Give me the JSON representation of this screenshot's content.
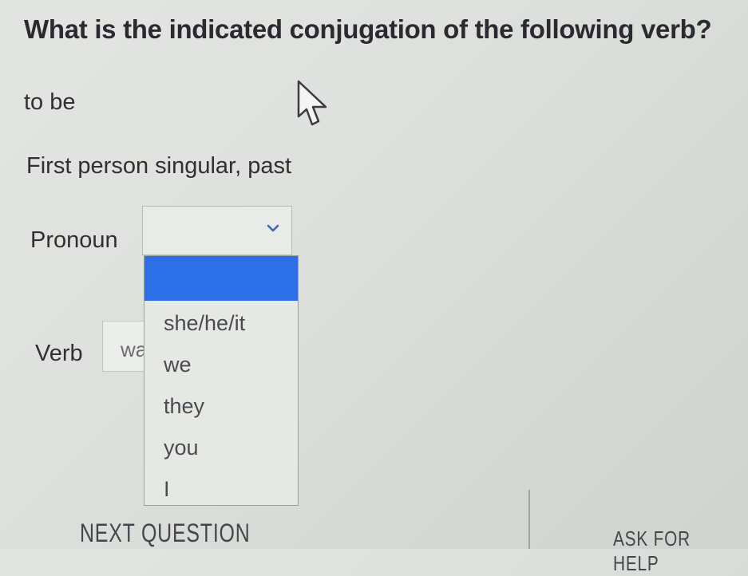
{
  "question": {
    "prompt": "What is the indicated conjugation of the following verb?"
  },
  "verb": {
    "term": "to be"
  },
  "instruction": {
    "text": "First person singular, past"
  },
  "pronoun": {
    "label": "Pronoun",
    "selected": "",
    "options": [
      {
        "label": "",
        "highlighted": true
      },
      {
        "label": "she/he/it"
      },
      {
        "label": "we"
      },
      {
        "label": "they"
      },
      {
        "label": "you"
      },
      {
        "label": "I"
      }
    ]
  },
  "verb_field": {
    "label": "Verb",
    "value": "wa"
  },
  "actions": {
    "next_label": "NEXT QUESTION",
    "help_label": "ASK FOR HELP"
  },
  "colors": {
    "highlight": "#2d6fe6"
  },
  "icons": {
    "cursor": "pointer-cursor-icon",
    "chevron": "chevron-down-icon"
  }
}
